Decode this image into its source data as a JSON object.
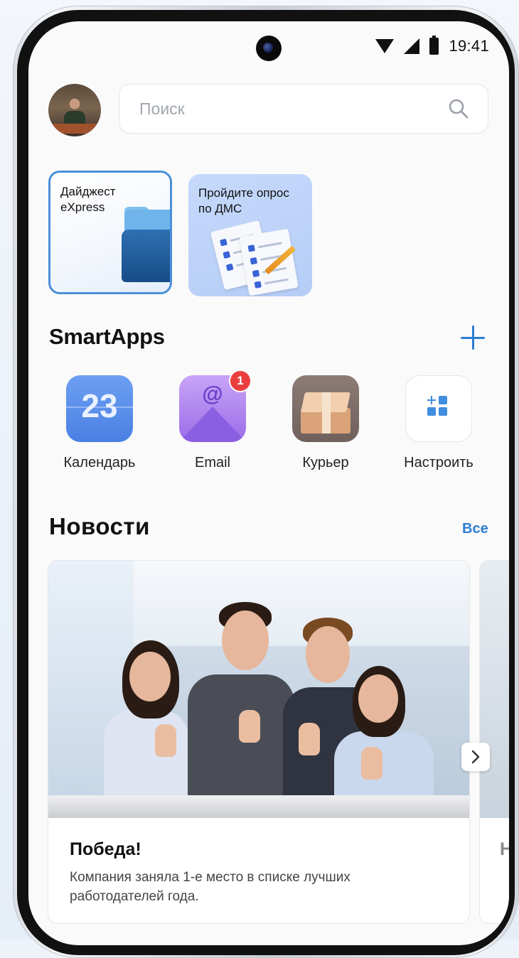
{
  "status_bar": {
    "time": "19:41"
  },
  "search": {
    "placeholder": "Поиск"
  },
  "stories": [
    {
      "title": "Дайджест eXpress"
    },
    {
      "title": "Пройдите опрос по ДМС"
    }
  ],
  "smartapps": {
    "title": "SmartApps",
    "apps": [
      {
        "label": "Календарь",
        "icon_text": "23"
      },
      {
        "label": "Email",
        "badge": "1",
        "icon_text": "@"
      },
      {
        "label": "Курьер"
      },
      {
        "label": "Настроить"
      }
    ]
  },
  "news": {
    "title": "Новости",
    "all_label": "Все",
    "items": [
      {
        "headline": "Победа!",
        "description": "Компания заняла 1-е место в списке лучших работодателей года."
      },
      {
        "headline": "Н"
      }
    ]
  },
  "colors": {
    "accent": "#2d7dd2",
    "badge": "#ea3d3d"
  }
}
